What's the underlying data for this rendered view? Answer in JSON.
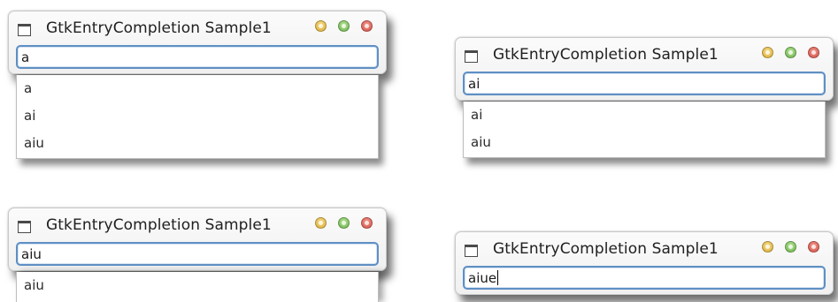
{
  "windows": [
    {
      "title": "GtkEntryCompletion Sample1",
      "entry_value": "a",
      "completions": [
        "a",
        "ai",
        "aiu"
      ]
    },
    {
      "title": "GtkEntryCompletion Sample1",
      "entry_value": "ai",
      "completions": [
        "ai",
        "aiu"
      ]
    },
    {
      "title": "GtkEntryCompletion Sample1",
      "entry_value": "aiu",
      "completions": [
        "aiu"
      ]
    },
    {
      "title": "GtkEntryCompletion Sample1",
      "entry_value": "aiue",
      "completions": []
    }
  ],
  "icons": {
    "window": "window-icon",
    "minimize": "minimize-button",
    "maximize": "maximize-button",
    "close": "close-button"
  },
  "colors": {
    "entry_focus_border": "#5f8fc4",
    "minimize": "#e2b53a",
    "maximize": "#6fb84c",
    "close": "#d9564a"
  }
}
